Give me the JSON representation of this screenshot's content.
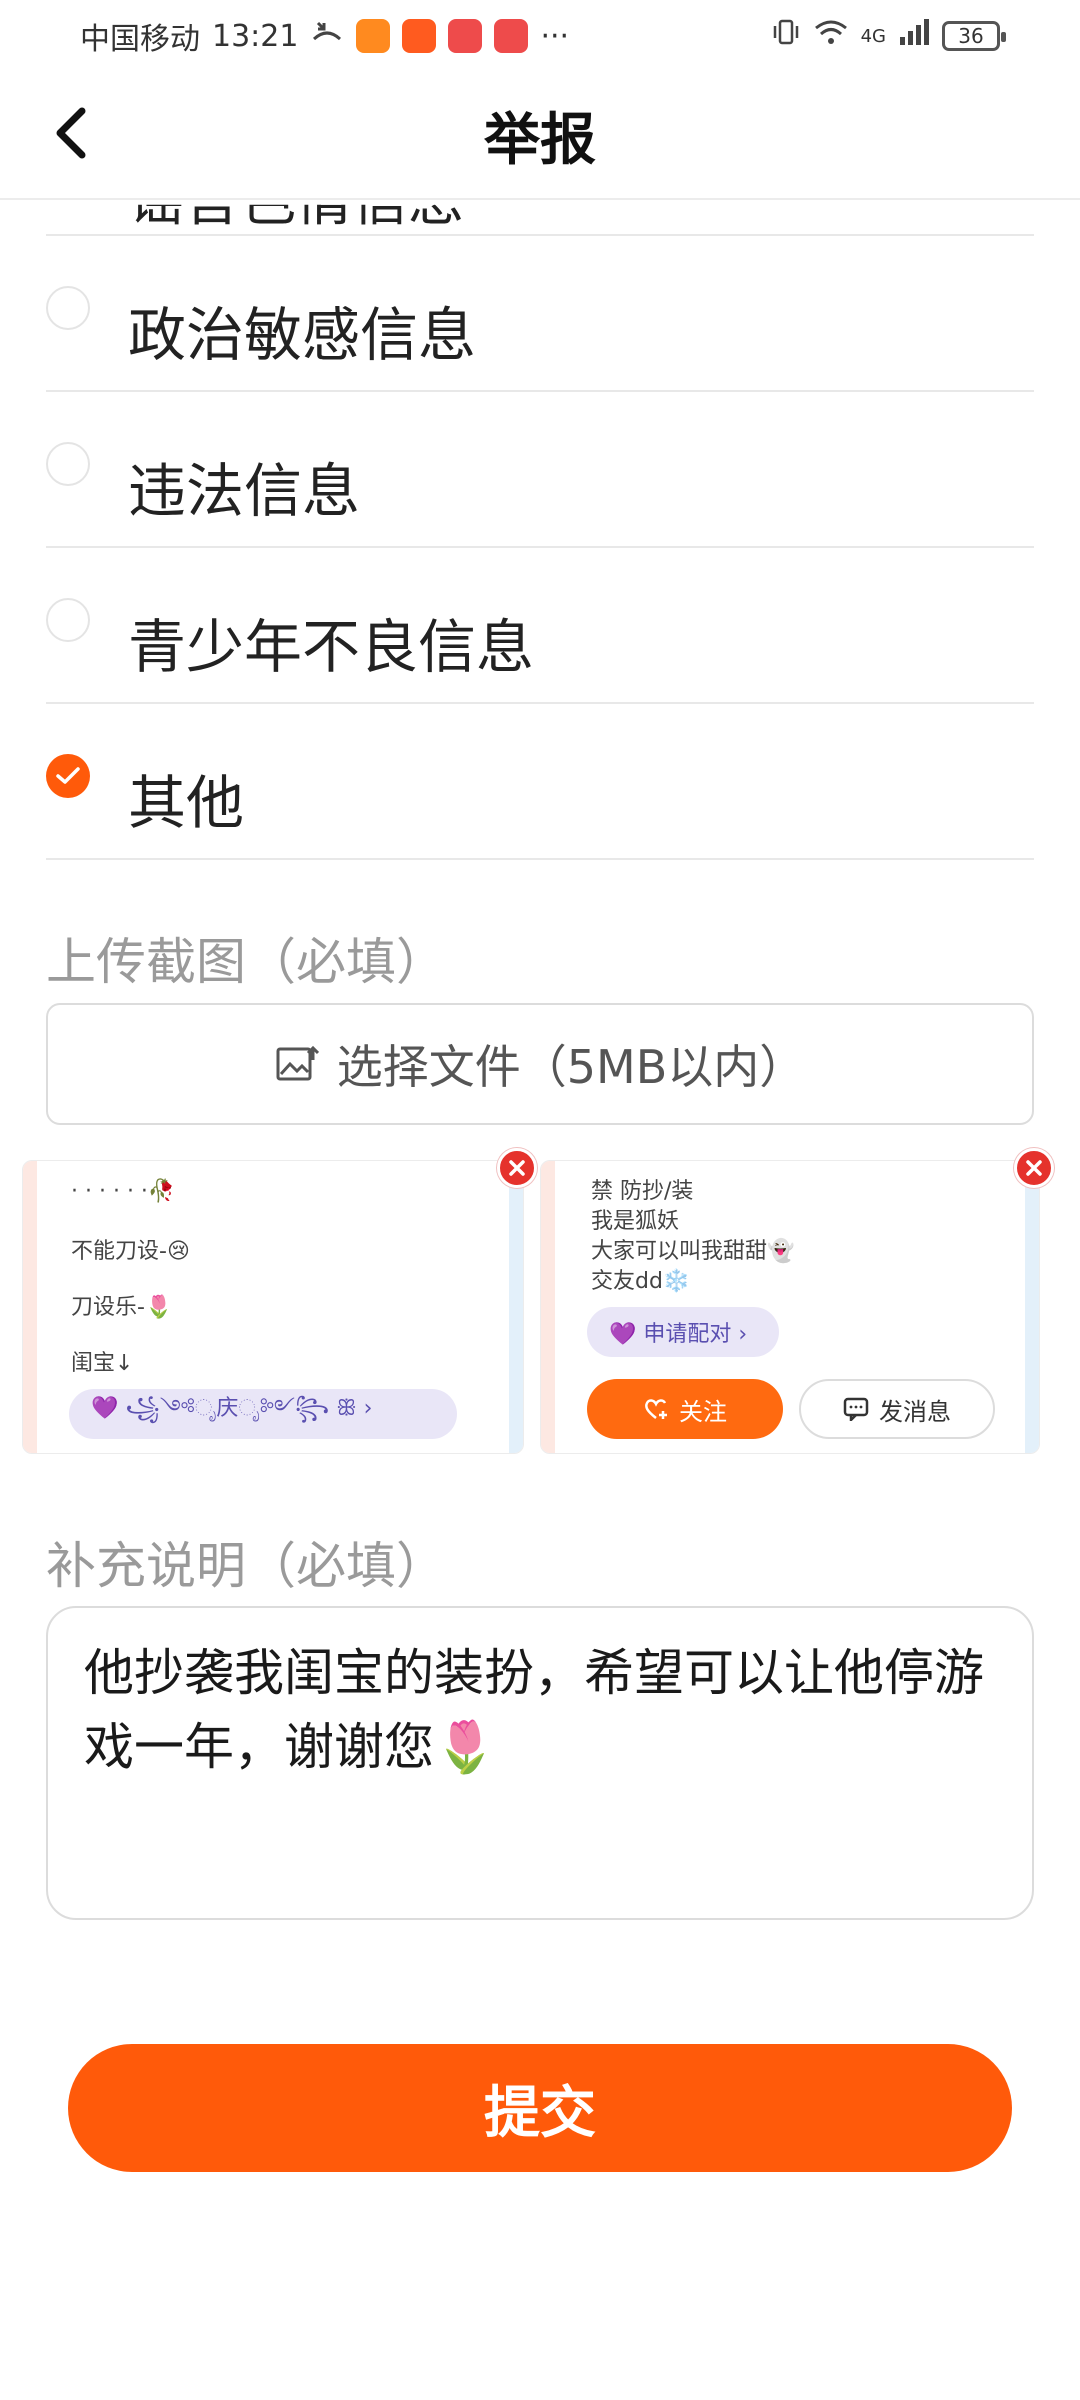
{
  "status_bar": {
    "carrier": "中国移动",
    "time": "13:21",
    "network": "4G",
    "battery": "36"
  },
  "header": {
    "title": "举报"
  },
  "options": {
    "partial_label": "谣言色情信息",
    "items": [
      {
        "label": "政治敏感信息",
        "checked": false
      },
      {
        "label": "违法信息",
        "checked": false
      },
      {
        "label": "青少年不良信息",
        "checked": false
      },
      {
        "label": "其他",
        "checked": true
      }
    ]
  },
  "upload": {
    "label": "上传截图（必填）",
    "button_label": "选择文件（5MB以内）"
  },
  "screenshots": [
    {
      "lines": [
        "· · · · · ·🥀",
        "不能刀设-😢",
        "刀设乐-🌷",
        "闺宝↓"
      ],
      "pill": "💜 ꧁༺ೃ庆ೃ༻꧂ ꕥ ›"
    },
    {
      "lines": [
        "禁 防抄/装",
        "我是狐妖",
        "大家可以叫我甜甜👻",
        "交友dd❄️"
      ],
      "pill": "💜 申请配对 ›",
      "follow_label": "关注",
      "message_label": "发消息"
    }
  ],
  "note": {
    "label": "补充说明（必填）",
    "value": "他抄袭我闺宝的装扮，希望可以让他停游戏一年，谢谢您🌷"
  },
  "submit": {
    "label": "提交"
  },
  "colors": {
    "accent": "#ff5a0a",
    "close_red": "#e5322c",
    "muted_text": "#9a9a9a"
  }
}
